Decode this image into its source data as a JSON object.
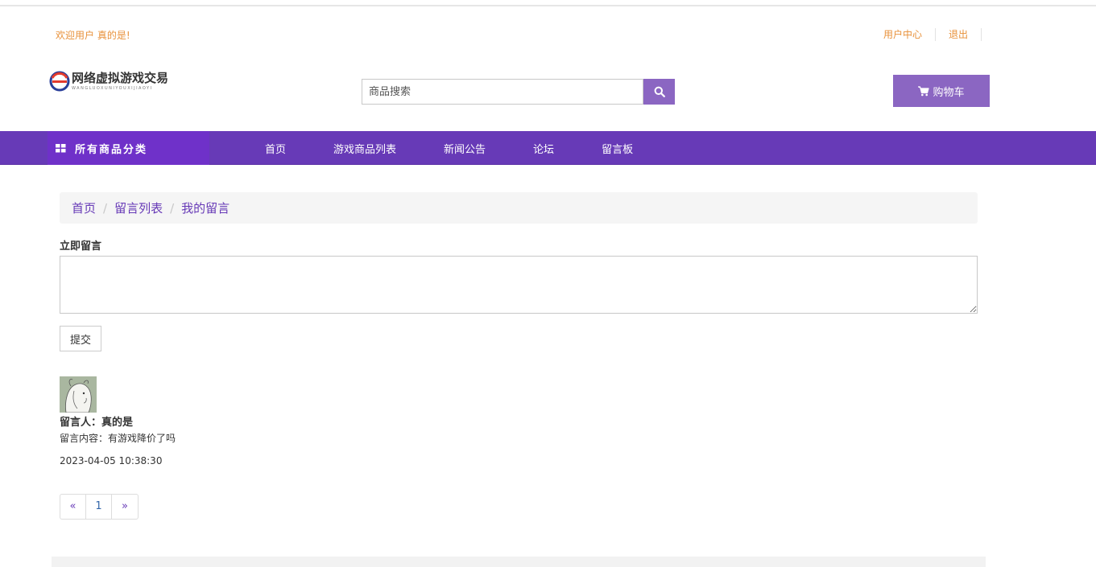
{
  "header": {
    "welcome": "欢迎用户 真的是!",
    "links": [
      "用户中心",
      "退出"
    ]
  },
  "logo": {
    "title": "网络虚拟游戏交易",
    "subtitle": "WANGLUOXUNIYOUXIJIAOYI"
  },
  "search": {
    "placeholder": "商品搜索"
  },
  "cart": {
    "label": "购物车"
  },
  "nav": {
    "category": "所有商品分类",
    "items": [
      "首页",
      "游戏商品列表",
      "新闻公告",
      "论坛",
      "留言板"
    ]
  },
  "breadcrumb": [
    "首页",
    "留言列表",
    "我的留言"
  ],
  "form": {
    "label": "立即留言",
    "submit": "提交"
  },
  "message": {
    "poster": "留言人：真的是",
    "content": "留言内容：有游戏降价了吗",
    "time": "2023-04-05 10:38:30"
  },
  "pagination": {
    "prev": "«",
    "page": "1",
    "next": "»"
  },
  "colors": {
    "accent": "#673ab7",
    "button": "#8b66c2",
    "orange": "#e8913a"
  }
}
